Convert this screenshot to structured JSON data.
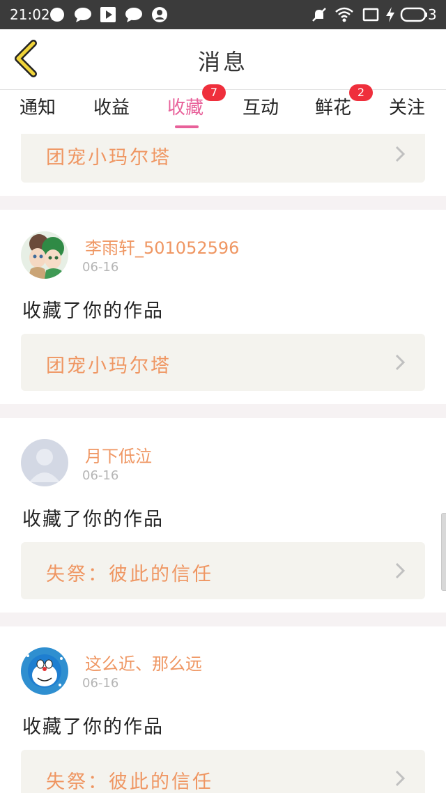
{
  "status_bar": {
    "time": "21:02",
    "battery_level": "3",
    "left_icons": [
      "chat-bubble-icon",
      "message-icon",
      "play-icon",
      "message-icon",
      "account-icon"
    ],
    "right_icons": [
      "mute-icon",
      "wifi-icon",
      "screen-icon",
      "charging-icon",
      "battery-icon"
    ]
  },
  "header": {
    "title": "消息",
    "back_icon": "chevron-left-icon",
    "accent_color": "#f0d43a"
  },
  "tabs": [
    {
      "label": "通知",
      "active": false
    },
    {
      "label": "收益",
      "active": false
    },
    {
      "label": "收藏",
      "active": true,
      "badge": "7"
    },
    {
      "label": "互动",
      "active": false
    },
    {
      "label": "鲜花",
      "active": false,
      "badge": "2"
    },
    {
      "label": "关注",
      "active": false
    }
  ],
  "colors": {
    "active_tab": "#e8619a",
    "badge": "#ef2f3c",
    "username": "#ef9662",
    "work_title": "#ef9662",
    "card_bg": "#f4f3ee"
  },
  "feed": {
    "partial_card_title": "团宠小玛尔塔",
    "items": [
      {
        "username": "李雨轩_501052596",
        "date": "06-16",
        "action": "收藏了你的作品",
        "work_title": "团宠小玛尔塔",
        "avatar": "anime-avatar"
      },
      {
        "username": "月下低泣",
        "date": "06-16",
        "action": "收藏了你的作品",
        "work_title": "失祭：彼此的信任",
        "avatar": "default-avatar"
      },
      {
        "username": "这么近、那么远",
        "date": "06-16",
        "action": "收藏了你的作品",
        "work_title": "失祭：彼此的信任",
        "avatar": "doraemon-avatar"
      }
    ]
  }
}
